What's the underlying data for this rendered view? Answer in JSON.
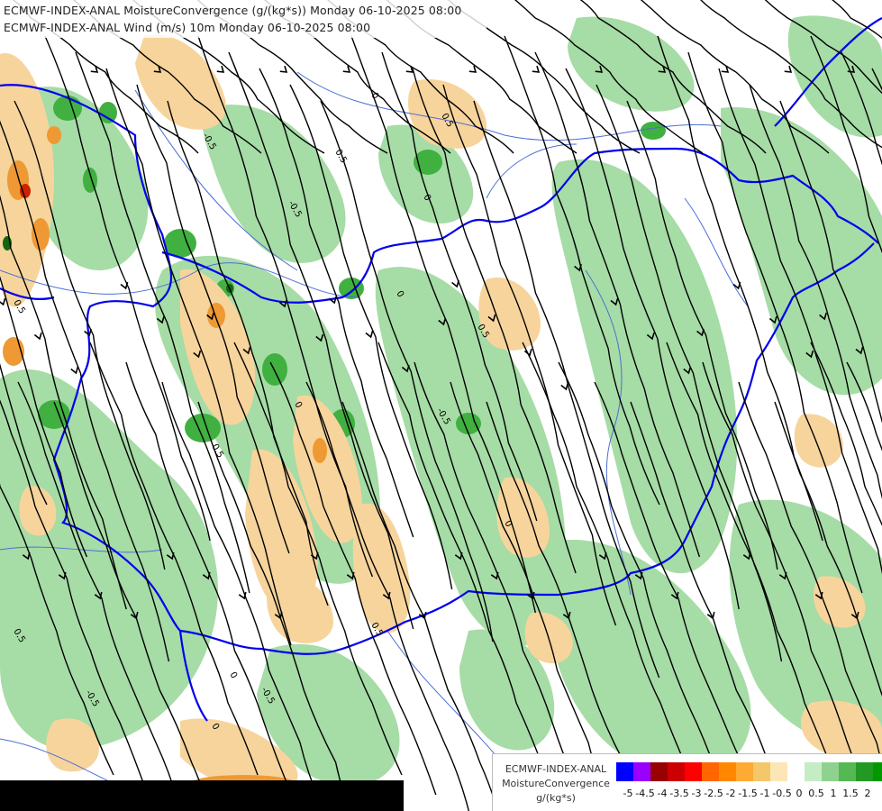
{
  "header": {
    "line1": "ECMWF-INDEX-ANAL MoistureConvergence (g/(kg*s)) Monday 06-10-2025 08:00",
    "line2": "ECMWF-INDEX-ANAL Wind (m/s) 10m Monday 06-10-2025 08:00"
  },
  "legend": {
    "line1": "ECMWF-INDEX-ANAL",
    "line2": "MoistureConvergence",
    "line3": "g/(kg*s)",
    "colors": [
      "#0000ff",
      "#9900ff",
      "#990000",
      "#cc0000",
      "#ff0000",
      "#ff6600",
      "#ff8800",
      "#ffaa33",
      "#f5c76b",
      "#fde6b6",
      "#ffffff",
      "#c6ecc6",
      "#8fd28f",
      "#55b855",
      "#229922",
      "#009900"
    ],
    "ticks": [
      "-5",
      "-4.5",
      "-4",
      "-3.5",
      "-3",
      "-2.5",
      "-2",
      "-1.5",
      "-1",
      "-0.5",
      "0",
      "0.5",
      "1",
      "1.5",
      "2"
    ]
  },
  "contour_labels": [
    "0",
    "0.5",
    "-0.5",
    "0.5",
    "0",
    "-0.5",
    "0.5",
    "0",
    "0.5",
    "-0.5",
    "0",
    "0.5",
    "0",
    "-0.5",
    "0.5",
    "0",
    "0.5",
    "0",
    "-0.5"
  ],
  "colors": {
    "border": "#0000ee",
    "river": "#4a6fd6",
    "streamline": "#000000",
    "convergence": "#a6dca6",
    "strong_convergence": "#40b040",
    "divergence": "#f7d49c",
    "strong_divergence": "#ee9933"
  }
}
